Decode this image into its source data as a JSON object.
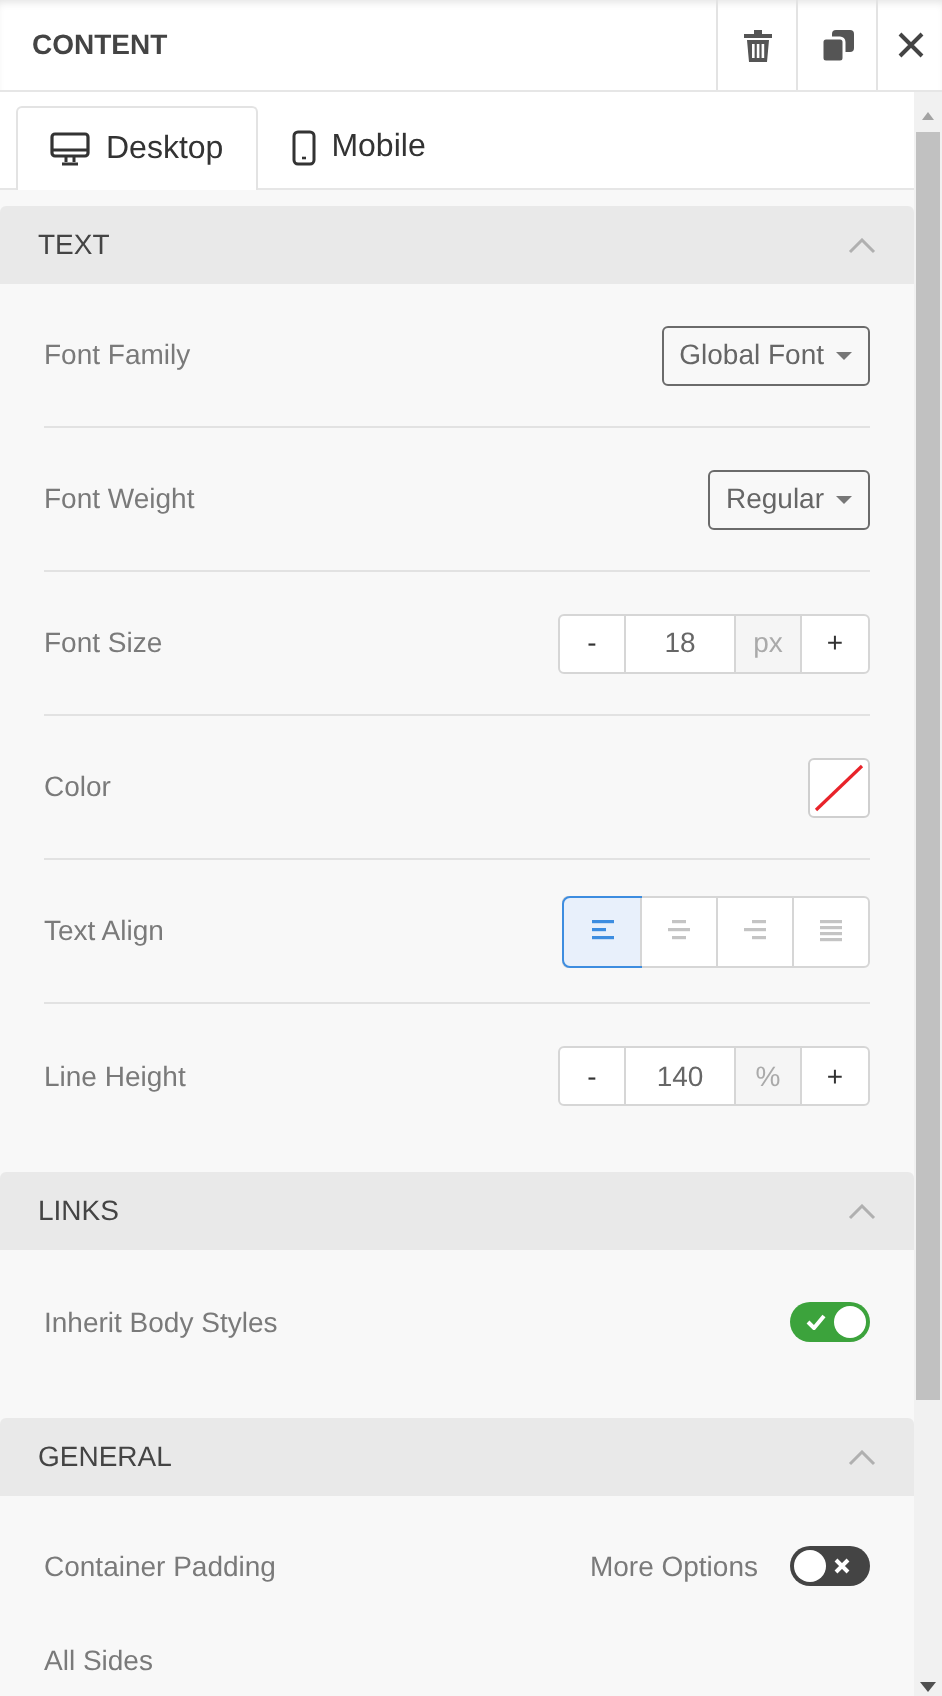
{
  "header": {
    "title": "CONTENT"
  },
  "tabs": [
    {
      "label": "Desktop",
      "kind": "desktop",
      "selected": true
    },
    {
      "label": "Mobile",
      "kind": "mobile",
      "selected": false
    }
  ],
  "sections": [
    {
      "title": "TEXT",
      "expanded": true,
      "rows": [
        {
          "kind": "dropdown",
          "label": "Font Family",
          "value": "Global Font"
        },
        {
          "kind": "dropdown",
          "label": "Font Weight",
          "value": "Regular"
        },
        {
          "kind": "stepper",
          "label": "Font Size",
          "minus": "-",
          "value": "18",
          "unit": "px",
          "plus": "+"
        },
        {
          "kind": "color",
          "label": "Color"
        },
        {
          "kind": "align",
          "label": "Text Align",
          "options": [
            {
              "kind": "left",
              "selected": true
            },
            {
              "kind": "center",
              "selected": false
            },
            {
              "kind": "right",
              "selected": false
            },
            {
              "kind": "justify",
              "selected": false
            }
          ]
        },
        {
          "kind": "stepper",
          "label": "Line Height",
          "minus": "-",
          "value": "140",
          "unit": "%",
          "plus": "+"
        }
      ]
    },
    {
      "title": "LINKS",
      "expanded": true,
      "rows": [
        {
          "kind": "toggle",
          "label": "Inherit Body Styles",
          "on": true
        }
      ]
    },
    {
      "title": "GENERAL",
      "expanded": true,
      "rows": [
        {
          "kind": "toggle",
          "label": "Container Padding",
          "toggle_label": "More Options",
          "on": false
        },
        {
          "kind": "label",
          "label": "All Sides"
        }
      ]
    }
  ]
}
